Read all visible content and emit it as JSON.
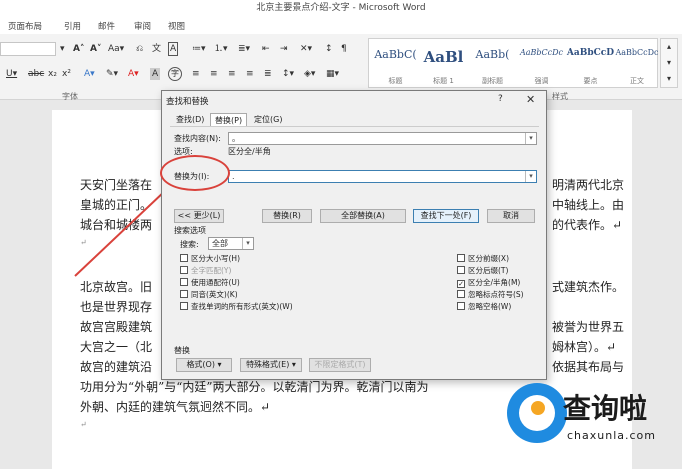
{
  "window": {
    "title": "北京主要景点介绍-文字 - Microsoft Word"
  },
  "ribbon_tabs": [
    "页面布局",
    "引用",
    "邮件",
    "审阅",
    "视图"
  ],
  "ribbon": {
    "font_group_label": "字体",
    "styles_group_label": "样式",
    "font_size_value": "",
    "styles": [
      {
        "preview": "AaBbC(",
        "name": "标题"
      },
      {
        "preview": "AaBl",
        "name": "标题 1"
      },
      {
        "preview": "AaBb(",
        "name": "副标题"
      },
      {
        "preview": "AaBbCcDc",
        "name": "强调"
      },
      {
        "preview": "AaBbCcD",
        "name": "要点"
      },
      {
        "preview": "AaBbCcDc",
        "name": "正文"
      }
    ]
  },
  "document": {
    "lines": [
      "天安门坐落在",
      "皇城的正门。",
      "城台和城楼两",
      "↵",
      "北京故宫。旧",
      "也是世界现存",
      "故宫宫殿建筑",
      "大宫之一（北",
      "故宫的建筑沿",
      "功用分为“外朝”与“内廷”两大部分。以乾清门为界。乾清门以南为",
      "外朝、内廷的建筑气氛迥然不同。↵",
      "↵"
    ],
    "right_lines": [
      "明清两代北京",
      "中轴线上。由",
      "的代表作。↵",
      "式建筑杰作。",
      "被誉为世界五",
      "姆林宫）。↵",
      "依据其布局与"
    ]
  },
  "dialog": {
    "title": "查找和替换",
    "help": "?",
    "close": "✕",
    "tabs": [
      "查找(D)",
      "替换(P)",
      "定位(G)"
    ],
    "active_tab": 1,
    "find_label": "查找内容(N):",
    "find_value": "。",
    "options_label": "选项:",
    "options_value": "区分全/半角",
    "replace_label": "替换为(I):",
    "replace_value": ".",
    "buttons": {
      "less": "<< 更少(L)",
      "replace": "替换(R)",
      "replace_all": "全部替换(A)",
      "find_next": "查找下一处(F)",
      "cancel": "取消"
    },
    "search_options_label": "搜索选项",
    "search_label": "搜索:",
    "search_value": "全部",
    "left_checks": [
      {
        "label": "区分大小写(H)",
        "checked": false,
        "disabled": false
      },
      {
        "label": "全字匹配(Y)",
        "checked": false,
        "disabled": true
      },
      {
        "label": "使用通配符(U)",
        "checked": false,
        "disabled": false
      },
      {
        "label": "同音(英文)(K)",
        "checked": false,
        "disabled": false
      },
      {
        "label": "查找单词的所有形式(英文)(W)",
        "checked": false,
        "disabled": false
      }
    ],
    "right_checks": [
      {
        "label": "区分前缀(X)",
        "checked": false
      },
      {
        "label": "区分后缀(T)",
        "checked": false
      },
      {
        "label": "区分全/半角(M)",
        "checked": true
      },
      {
        "label": "忽略标点符号(S)",
        "checked": false
      },
      {
        "label": "忽略空格(W)",
        "checked": false
      }
    ],
    "replace_section_label": "替换",
    "format_button": "格式(O) ▾",
    "special_button": "特殊格式(E) ▾",
    "no_format_button": "不限定格式(T)"
  },
  "watermark": {
    "brand": "查询啦",
    "url": "chaxunla.com"
  }
}
